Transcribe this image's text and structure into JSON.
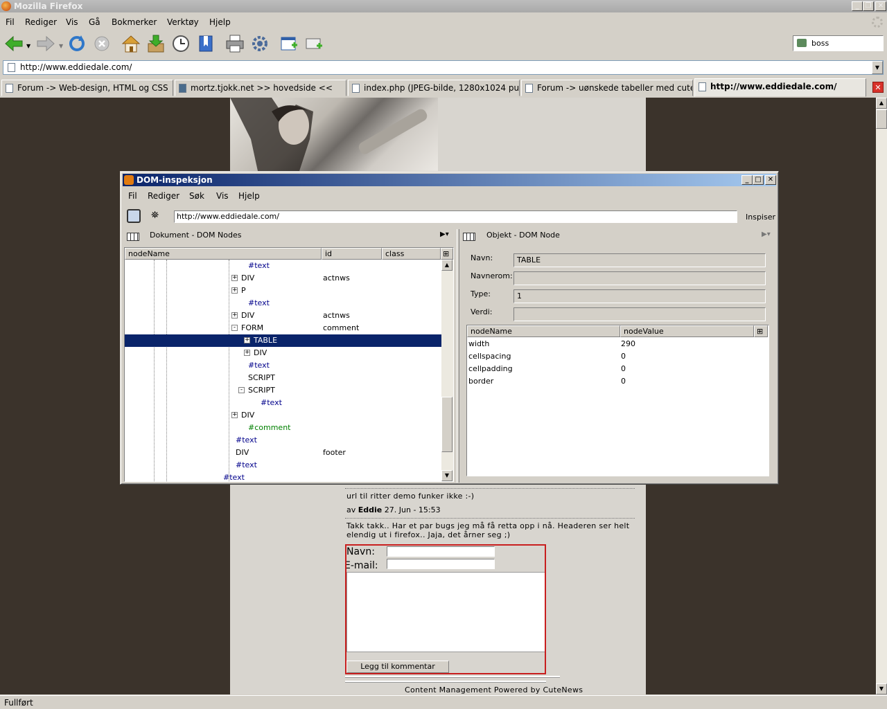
{
  "window": {
    "title": "Mozilla Firefox"
  },
  "menubar": [
    "Fil",
    "Rediger",
    "Vis",
    "Gå",
    "Bokmerker",
    "Verktøy",
    "Hjelp"
  ],
  "search": {
    "value": "boss"
  },
  "urlbar": {
    "value": "http://www.eddiedale.com/"
  },
  "tabs": [
    {
      "label": "Forum -> Web-design, HTML og CSS"
    },
    {
      "label": "mortz.tjokk.net >> hovedside <<"
    },
    {
      "label": "index.php (JPEG-bilde, 1280x1024 punkter)"
    },
    {
      "label": "Forum -> uønskede tabeller med cutenews"
    },
    {
      "label": "http://www.eddiedale.com/"
    }
  ],
  "page": {
    "comment1": "url til ritter demo funker ikke :-)",
    "byline_prefix": "av",
    "byline_author": "Eddie",
    "byline_date": "27. Jun - 15:53",
    "comment2": "Takk takk.. Har et par bugs jeg må få retta opp i nå. Headeren ser helt elendig ut i firefox.. Jaja, det årner seg ;)",
    "form": {
      "name_label": "Navn:",
      "email_label": "E-mail:",
      "submit_label": "Legg til kommentar"
    },
    "footer": "Content Management Powered by CuteNews"
  },
  "status": "Fullført",
  "dom": {
    "title": "DOM-inspeksjon",
    "menubar": [
      "Fil",
      "Rediger",
      "Søk",
      "Vis",
      "Hjelp"
    ],
    "url": "http://www.eddiedale.com/",
    "inspect_button": "Inspiser",
    "left_panel_title": "Dokument - DOM Nodes",
    "right_panel_title": "Objekt - DOM Node",
    "columns": {
      "nodename": "nodeName",
      "id": "id",
      "class": "class"
    },
    "tree": [
      {
        "name": "#text",
        "id": "",
        "type": "text"
      },
      {
        "name": "DIV",
        "id": "actnws",
        "type": "el",
        "exp": "+"
      },
      {
        "name": "P",
        "id": "",
        "type": "el",
        "exp": "+"
      },
      {
        "name": "#text",
        "id": "",
        "type": "text"
      },
      {
        "name": "DIV",
        "id": "actnws",
        "type": "el",
        "exp": "+"
      },
      {
        "name": "FORM",
        "id": "comment",
        "type": "el",
        "exp": "-"
      },
      {
        "name": "TABLE",
        "id": "",
        "type": "el",
        "exp": "+",
        "sel": true
      },
      {
        "name": "DIV",
        "id": "",
        "type": "el",
        "exp": "+"
      },
      {
        "name": "#text",
        "id": "",
        "type": "text"
      },
      {
        "name": "SCRIPT",
        "id": "",
        "type": "el"
      },
      {
        "name": "SCRIPT",
        "id": "",
        "type": "el",
        "exp": "-"
      },
      {
        "name": "#text",
        "id": "",
        "type": "text"
      },
      {
        "name": "DIV",
        "id": "",
        "type": "el",
        "exp": "+"
      },
      {
        "name": "#comment",
        "id": "",
        "type": "comment"
      },
      {
        "name": "#text",
        "id": "",
        "type": "text"
      },
      {
        "name": "DIV",
        "id": "footer",
        "type": "el"
      },
      {
        "name": "#text",
        "id": "",
        "type": "text"
      },
      {
        "name": "#text",
        "id": "",
        "type": "text"
      }
    ],
    "fields": {
      "navn_label": "Navn:",
      "navn": "TABLE",
      "navnerom_label": "Navnerom:",
      "navnerom": "",
      "type_label": "Type:",
      "type": "1",
      "verdi_label": "Verdi:",
      "verdi": ""
    },
    "attr_columns": {
      "name": "nodeName",
      "value": "nodeValue"
    },
    "attrs": [
      {
        "name": "width",
        "value": "290"
      },
      {
        "name": "cellspacing",
        "value": "0"
      },
      {
        "name": "cellpadding",
        "value": "0"
      },
      {
        "name": "border",
        "value": "0"
      }
    ]
  }
}
